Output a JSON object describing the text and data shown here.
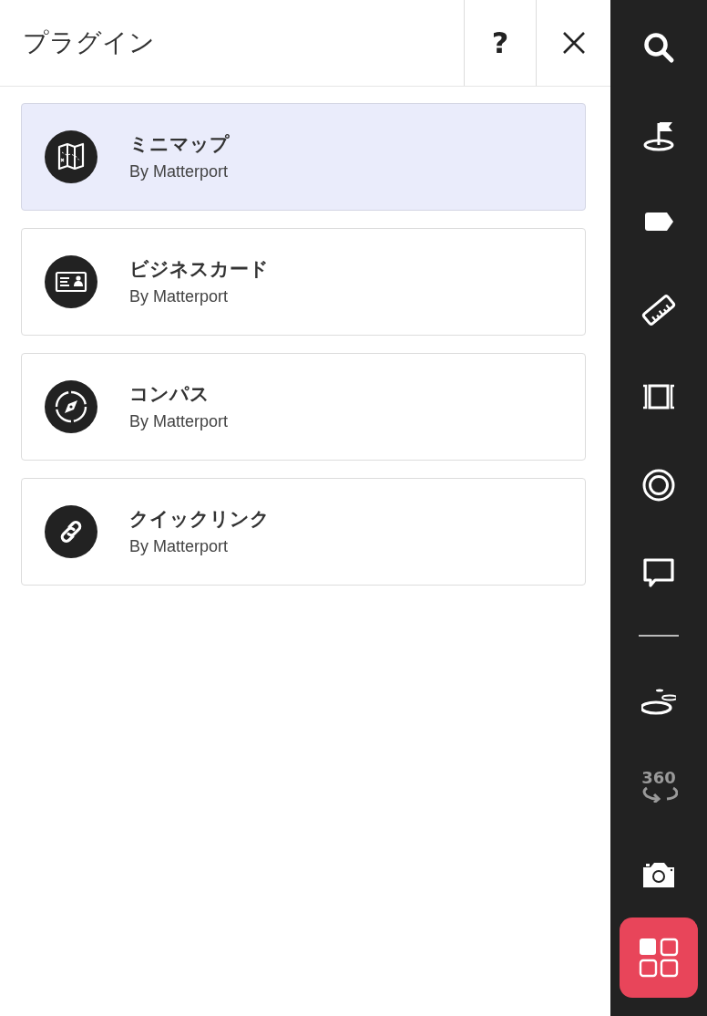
{
  "panel": {
    "title": "プラグイン",
    "help_button": "?"
  },
  "plugins": [
    {
      "kind": "map",
      "name": "ミニマップ",
      "author": "By Matterport",
      "selected": true
    },
    {
      "kind": "card",
      "name": "ビジネスカード",
      "author": "By Matterport",
      "selected": false
    },
    {
      "kind": "compass",
      "name": "コンパス",
      "author": "By Matterport",
      "selected": false
    },
    {
      "kind": "link",
      "name": "クイックリンク",
      "author": "By Matterport",
      "selected": false
    }
  ],
  "toolbar": {
    "top": [
      {
        "kind": "search",
        "selected": false,
        "disabled": false
      },
      {
        "kind": "flag",
        "selected": false,
        "disabled": false
      },
      {
        "kind": "tag",
        "selected": false,
        "disabled": false
      },
      {
        "kind": "ruler",
        "selected": false,
        "disabled": false
      },
      {
        "kind": "frame",
        "selected": false,
        "disabled": false
      },
      {
        "kind": "target",
        "selected": false,
        "disabled": false
      },
      {
        "kind": "comment",
        "selected": false,
        "disabled": false
      }
    ],
    "bottom": [
      {
        "kind": "floors",
        "selected": false,
        "disabled": false
      },
      {
        "kind": "orbit",
        "label": "360",
        "selected": false,
        "disabled": true
      },
      {
        "kind": "camera",
        "selected": false,
        "disabled": false
      },
      {
        "kind": "grid",
        "selected": true,
        "disabled": false
      }
    ]
  }
}
